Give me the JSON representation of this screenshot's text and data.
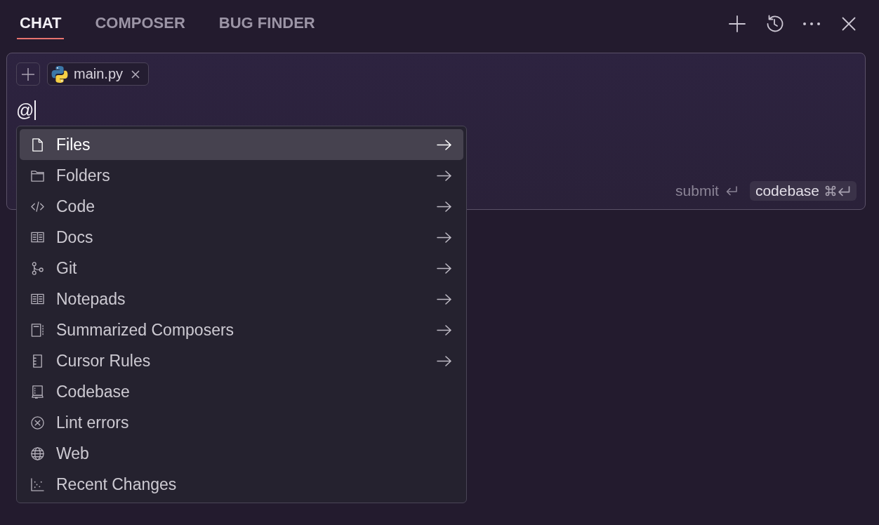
{
  "tabs": [
    {
      "label": "CHAT",
      "selected": true
    },
    {
      "label": "COMPOSER",
      "selected": false
    },
    {
      "label": "BUG FINDER",
      "selected": false
    }
  ],
  "composer": {
    "context_chips": [
      {
        "label": "main.py"
      }
    ],
    "input": {
      "value": "@"
    },
    "submit_hint": {
      "label": "submit"
    },
    "codebase_hint": {
      "label": "codebase"
    }
  },
  "mention_menu": {
    "items": [
      {
        "label": "Files",
        "selected": true,
        "submenu": true
      },
      {
        "label": "Folders",
        "selected": false,
        "submenu": true
      },
      {
        "label": "Code",
        "selected": false,
        "submenu": true
      },
      {
        "label": "Docs",
        "selected": false,
        "submenu": true
      },
      {
        "label": "Git",
        "selected": false,
        "submenu": true
      },
      {
        "label": "Notepads",
        "selected": false,
        "submenu": true
      },
      {
        "label": "Summarized Composers",
        "selected": false,
        "submenu": true
      },
      {
        "label": "Cursor Rules",
        "selected": false,
        "submenu": true
      },
      {
        "label": "Codebase",
        "selected": false,
        "submenu": false
      },
      {
        "label": "Lint errors",
        "selected": false,
        "submenu": false
      },
      {
        "label": "Web",
        "selected": false,
        "submenu": false
      },
      {
        "label": "Recent Changes",
        "selected": false,
        "submenu": false
      }
    ]
  }
}
